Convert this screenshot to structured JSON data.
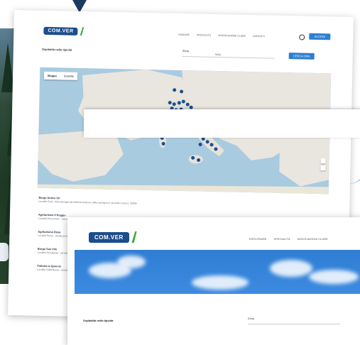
{
  "header": {
    "logo": "COM.VER",
    "nav": [
      "NAZIONE",
      "SPECIALITÀ",
      "ASSOCIAZIONE CLUBS",
      "CONTATTI"
    ],
    "button": "ACCEDI"
  },
  "search": {
    "label": "Ospitalità nella tipicità",
    "field_label": "Zona",
    "field_value": "Italia",
    "button": "CERCA ORA"
  },
  "map": {
    "tabs": [
      "Mappa",
      "Satellite"
    ]
  },
  "results": [
    {
      "title": "Borgo Antico Srl",
      "desc": "Località Piani - Azienda agricola della lavorazione della castagna in via della Costa 5, 20048"
    },
    {
      "title": "Agriturismo Il Poggio",
      "desc": "Località Roccamare - azienda agricola biologica con vista sulla valle"
    },
    {
      "title": "Agriturismo Rosa",
      "desc": "Località Pietra - strada provinciale 12"
    },
    {
      "title": "Borgo San Vito",
      "desc": "Località Serralunga - via del Fiume 3"
    },
    {
      "title": "Fattoria la Quercia",
      "desc": "Località Vallombrosa - strada comunale 8"
    }
  ],
  "front_card": {
    "logo": "COM.VER",
    "nav": [
      "ESPLORARE",
      "SPECIALITÀ",
      "ASSOCIAZIONI CLUBS"
    ],
    "search_label": "Ospitalità nella tipicità",
    "field_label": "Zona"
  },
  "colors": {
    "brand_blue": "#1c4d8c",
    "button_blue": "#2f7fd1",
    "marker": "#1d4e8e",
    "sea": "#a9cbe0",
    "land": "#e9e6df"
  }
}
